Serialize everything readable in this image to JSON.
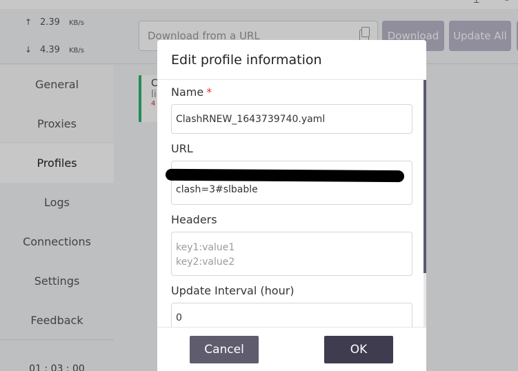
{
  "window": {
    "pin_glyph": "⊥",
    "minimize_glyph": "–"
  },
  "sidebar": {
    "traffic": {
      "upload_arrow": "↑",
      "upload_value": "2.39",
      "upload_unit": "KB/s",
      "download_arrow": "↓",
      "download_value": "4.39",
      "download_unit": "KB/s"
    },
    "items": [
      {
        "label": "General"
      },
      {
        "label": "Proxies"
      },
      {
        "label": "Profiles"
      },
      {
        "label": "Logs"
      },
      {
        "label": "Connections"
      },
      {
        "label": "Settings"
      },
      {
        "label": "Feedback"
      }
    ],
    "active_item": "Profiles",
    "time": "01 : 03 : 00"
  },
  "toolbar": {
    "url_placeholder": "Download from a URL",
    "download_label": "Download",
    "update_all_label": "Update All"
  },
  "profile_card": {
    "line1": "C",
    "line2": "li",
    "line3": "4"
  },
  "modal": {
    "title": "Edit profile information",
    "name_label": "Name",
    "required_mark": "*",
    "name_value": "ClashRNEW_1643739740.yaml",
    "url_label": "URL",
    "url_value_visible": "clash=3#slbable",
    "headers_label": "Headers",
    "headers_placeholder_line1": "key1:value1",
    "headers_placeholder_line2": "key2:value2",
    "interval_label": "Update Interval (hour)",
    "interval_value": "0",
    "cancel_label": "Cancel",
    "ok_label": "OK"
  },
  "colors": {
    "accent_green": "#2fb36e",
    "button_dark": "#3e3c4e",
    "button_cancel": "#5f5c6e",
    "required_red": "#e5322d"
  }
}
